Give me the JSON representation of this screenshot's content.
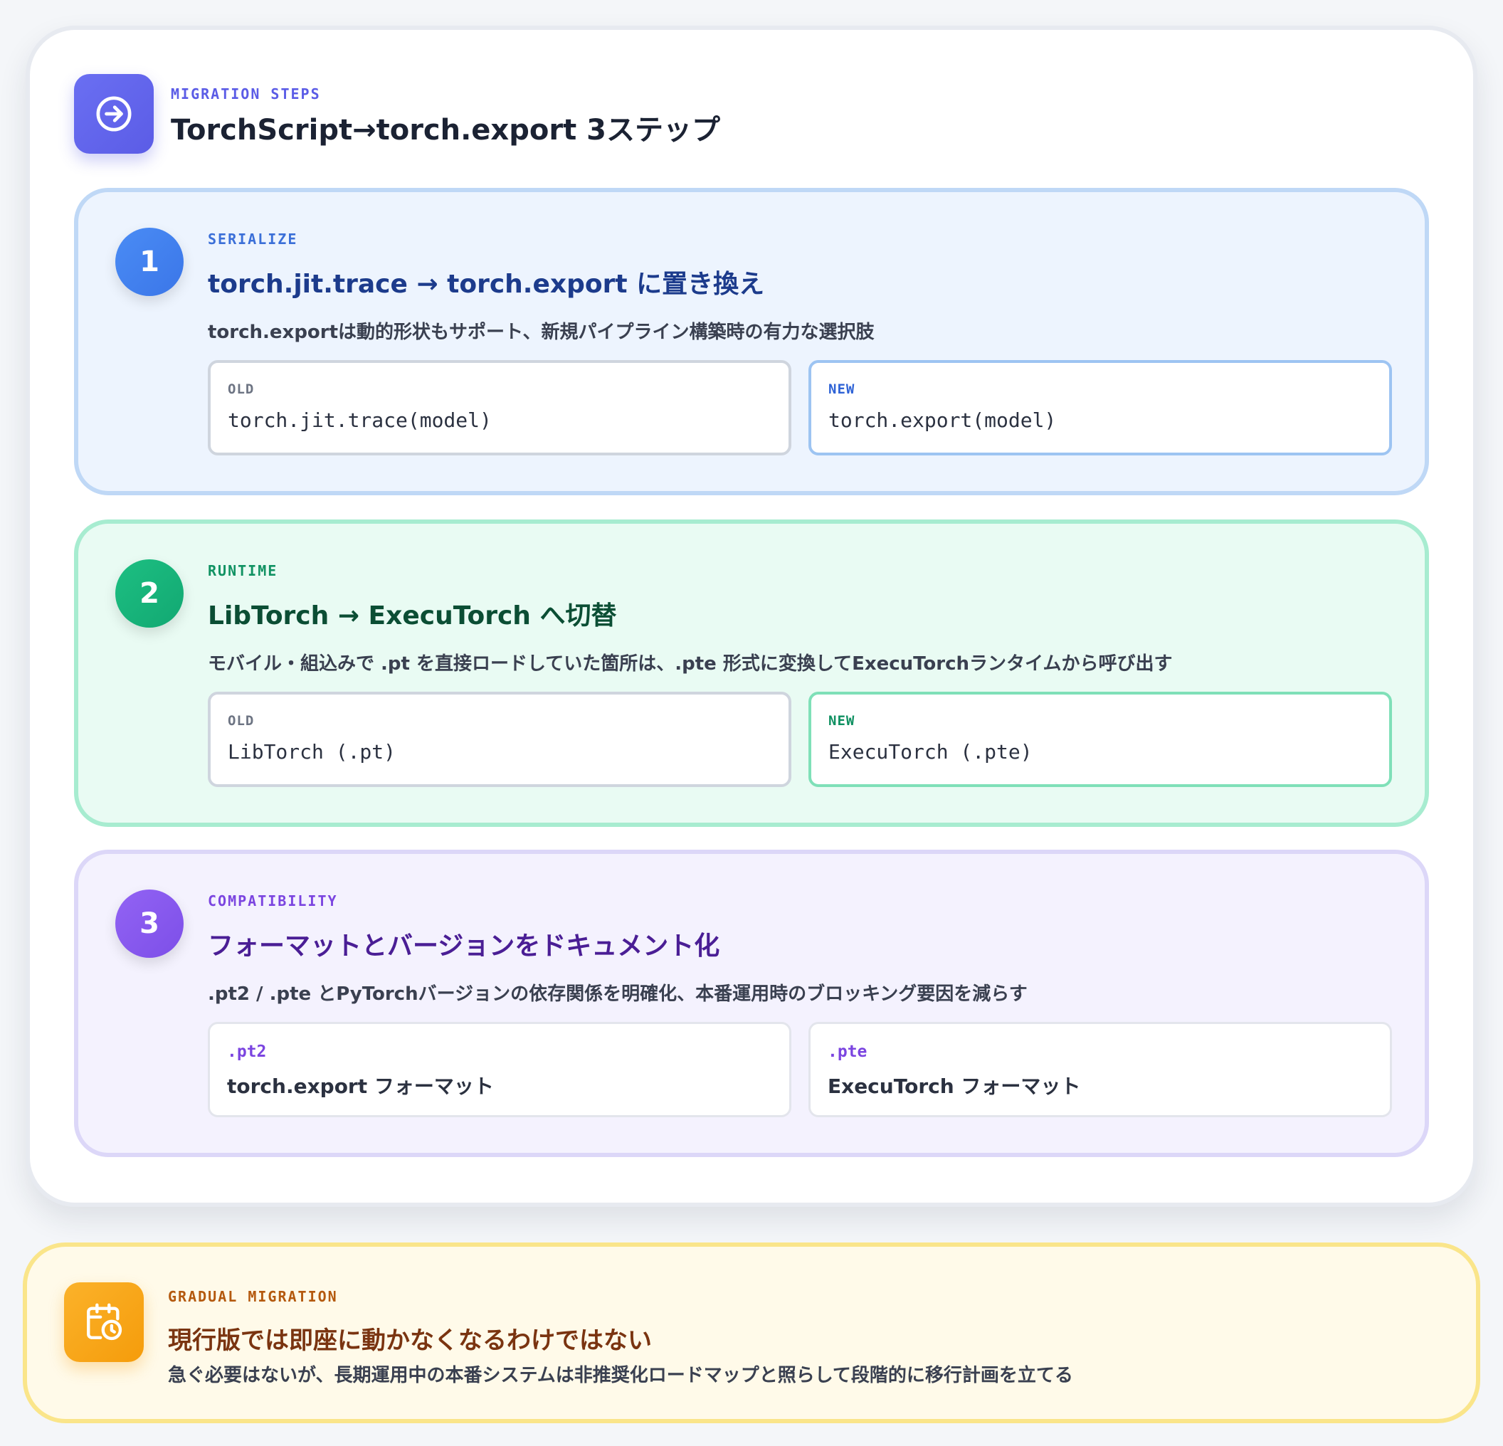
{
  "header": {
    "icon": "arrow-right-circle-icon",
    "eyebrow": "MIGRATION STEPS",
    "title": "TorchScript→torch.export 3ステップ",
    "accent": "#5b5ce6"
  },
  "steps": [
    {
      "number": "1",
      "eyebrow": "SERIALIZE",
      "title": "torch.jit.trace → torch.export に置き換え",
      "description": "torch.exportは動的形状もサポート、新規パイプライン構築時の有力な選択肢",
      "left_box": {
        "label": "OLD",
        "value": "torch.jit.trace(model)"
      },
      "right_box": {
        "label": "NEW",
        "value": "torch.export(model)"
      },
      "accent": "#3b76e8"
    },
    {
      "number": "2",
      "eyebrow": "RUNTIME",
      "title": "LibTorch → ExecuTorch へ切替",
      "description": "モバイル・組込みで .pt を直接ロードしていた箇所は、.pte 形式に変換してExecuTorchランタイムから呼び出す",
      "left_box": {
        "label": "OLD",
        "value": "LibTorch (.pt)"
      },
      "right_box": {
        "label": "NEW",
        "value": "ExecuTorch (.pte)"
      },
      "accent": "#12a872"
    },
    {
      "number": "3",
      "eyebrow": "COMPATIBILITY",
      "title": "フォーマットとバージョンをドキュメント化",
      "description": ".pt2 / .pte とPyTorchバージョンの依存関係を明確化、本番運用時のブロッキング要因を減らす",
      "left_box": {
        "label": ".pt2",
        "value": "torch.export フォーマット"
      },
      "right_box": {
        "label": ".pte",
        "value": "ExecuTorch フォーマット"
      },
      "accent": "#7d4fe8"
    }
  ],
  "callout": {
    "icon": "calendar-clock-icon",
    "eyebrow": "GRADUAL MIGRATION",
    "title": "現行版では即座に動かなくなるわけではない",
    "description": "急ぐ必要はないが、長期運用中の本番システムは非推奨化ロードマップと照らして段階的に移行計画を立てる",
    "accent": "#f59c0b"
  }
}
